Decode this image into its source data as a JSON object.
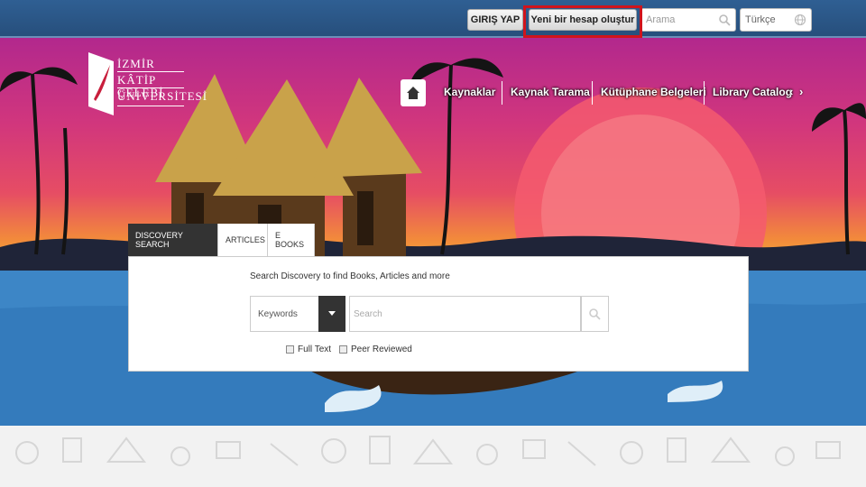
{
  "topbar": {
    "login_label": "GIRIŞ YAP",
    "register_label": "Yeni bir hesap oluştur",
    "search_placeholder": "Arama",
    "language_value": "Türkçe"
  },
  "logo": {
    "lines": [
      "İZMİR",
      "KÂTİP ÇELEBİ",
      "ÜNİVERSİTESİ"
    ]
  },
  "nav": {
    "items": [
      "Kaynaklar",
      "Kaynak Tarama",
      "Kütüphane Belgeleri",
      "Library Catalog"
    ],
    "prev": "‹",
    "next": "›"
  },
  "discovery": {
    "tabs": [
      "DISCOVERY SEARCH",
      "ARTICLES",
      "E BOOKS"
    ],
    "caption": "Search Discovery to find Books, Articles and more",
    "field_select": "Keywords",
    "search_placeholder": "Search",
    "options": [
      "Full Text",
      "Peer Reviewed"
    ]
  },
  "colors": {
    "topbar": "#2f5f93",
    "highlight": "#d0141c",
    "tab_active": "#333333"
  }
}
